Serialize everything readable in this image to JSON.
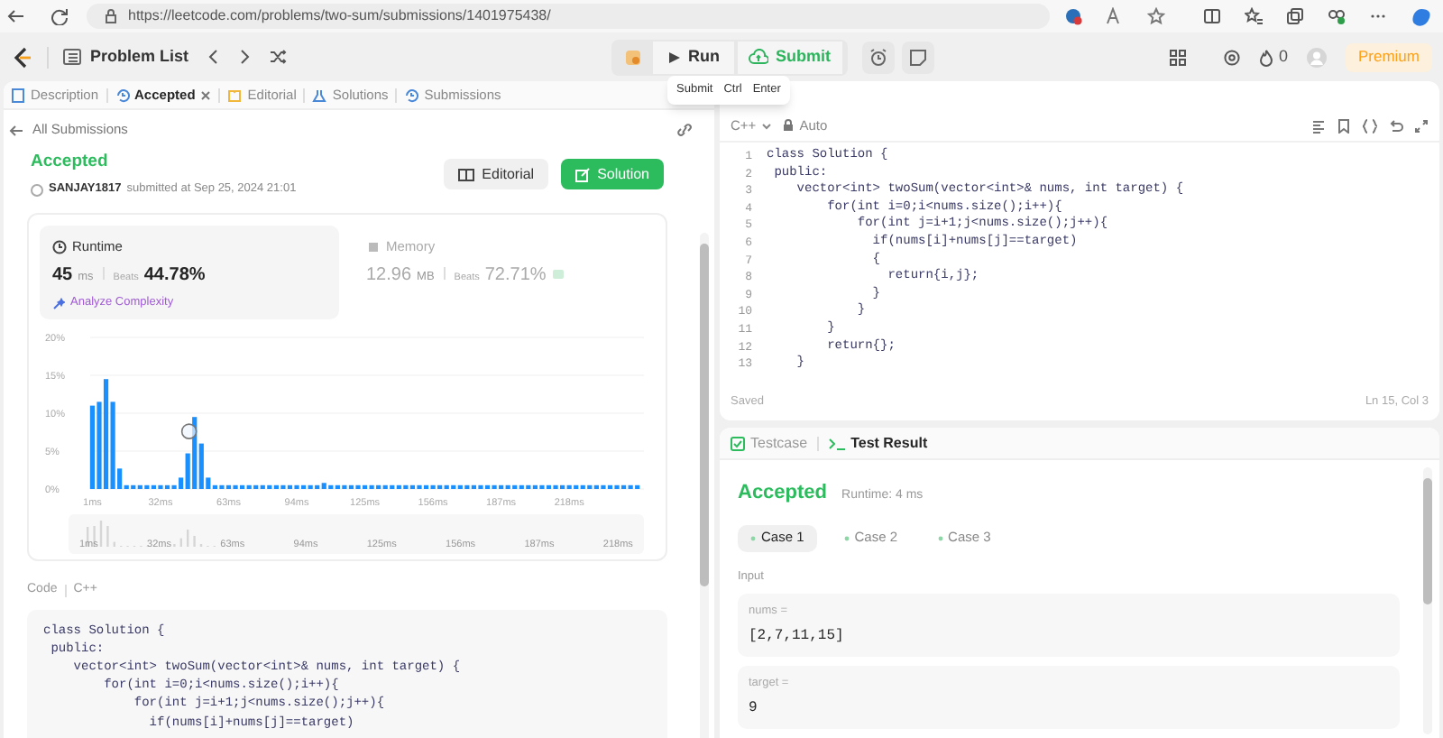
{
  "browser": {
    "url": "https://leetcode.com/problems/two-sum/submissions/1401975438/"
  },
  "nav": {
    "problem_list": "Problem List",
    "run": "Run",
    "submit": "Submit",
    "streak": "0",
    "premium": "Premium"
  },
  "tooltip": {
    "label": "Submit",
    "keys": [
      "Ctrl",
      "Enter"
    ]
  },
  "tabs": [
    {
      "label": "Description",
      "selected": false,
      "closable": false
    },
    {
      "label": "Accepted",
      "selected": true,
      "closable": true
    },
    {
      "label": "Editorial",
      "selected": false,
      "closable": false
    },
    {
      "label": "Solutions",
      "selected": false,
      "closable": false
    },
    {
      "label": "Submissions",
      "selected": false,
      "closable": false
    }
  ],
  "submission": {
    "back": "All Submissions",
    "status": "Accepted",
    "user": "SANJAY1817",
    "submitted": "submitted at Sep 25, 2024 21:01",
    "buttons": [
      {
        "label": "Editorial",
        "kind": "secondary"
      },
      {
        "label": "Solution",
        "kind": "primary"
      }
    ]
  },
  "stats": [
    {
      "title": "Runtime",
      "selected": true,
      "value": "45",
      "unit": "ms",
      "beats_label": "Beats",
      "beats": "44.78%",
      "link": "Analyze Complexity"
    },
    {
      "title": "Memory",
      "selected": false,
      "value": "12.96",
      "unit": "MB",
      "beats_label": "Beats",
      "beats": "72.71%"
    }
  ],
  "runtime_distribution": {
    "chart_data": {
      "type": "bar",
      "xlim": [
        0,
        252
      ],
      "ylim": [
        0,
        20
      ],
      "x": [
        1,
        4.1,
        7.2,
        10.3,
        13.4,
        16.5,
        19.6,
        22.7,
        25.8,
        28.9,
        32,
        35.1,
        38.2,
        41.3,
        44.4,
        47.5,
        50.6,
        53.7,
        56.8,
        59.9,
        63,
        66.1,
        69.2,
        72.3,
        75.4,
        78.5,
        81.6,
        84.7,
        87.8,
        90.9,
        94,
        97.1,
        100.2,
        103.3,
        106.4,
        109.5,
        112.6,
        115.7,
        118.8,
        121.9,
        125,
        128.1,
        131.2,
        134.3,
        137.4,
        140.5,
        143.6,
        146.7,
        149.8,
        152.9,
        156,
        159.1,
        162.2,
        165.3,
        168.4,
        171.5,
        174.6,
        177.7,
        180.8,
        183.9,
        187,
        190.1,
        193.2,
        196.3,
        199.4,
        202.5,
        205.6,
        208.7,
        211.8,
        214.9,
        218,
        221.1,
        224.2,
        227.3,
        230.4,
        233.5,
        236.6,
        239.7,
        242.8,
        245.9,
        249
      ],
      "grid": true,
      "series": [
        {
          "color": "#1a90ff",
          "values": [
            11,
            11.5,
            14.5,
            11.5,
            2.7,
            0.5,
            0.5,
            0.5,
            0.5,
            0.5,
            0.5,
            0.5,
            0.5,
            1.5,
            4.7,
            9.5,
            6,
            1.5,
            0.5,
            0.5,
            0.5,
            0.5,
            0.5,
            0.5,
            0.5,
            0.5,
            0.5,
            0.5,
            0.5,
            0.5,
            0.5,
            0.5,
            0.5,
            0.5,
            0.8,
            0.5,
            0.5,
            0.5,
            0.5,
            0.5,
            0.5,
            0.5,
            0.5,
            0.5,
            0.5,
            0.5,
            0.5,
            0.5,
            0.5,
            0.5,
            0.5,
            0.5,
            0.5,
            0.5,
            0.5,
            0.5,
            0.5,
            0.5,
            0.5,
            0.5,
            0.5,
            0.5,
            0.5,
            0.5,
            0.5,
            0.5,
            0.5,
            0.5,
            0.5,
            0.5,
            0.5,
            0.5,
            0.5,
            0.5,
            0.5,
            0.5,
            0.5,
            0.5,
            0.5,
            0.5,
            0.5
          ]
        }
      ],
      "xticks": [
        {
          "value": 1,
          "label": "1ms"
        },
        {
          "value": 32,
          "label": "32ms"
        },
        {
          "value": 63,
          "label": "63ms"
        },
        {
          "value": 94,
          "label": "94ms"
        },
        {
          "value": 125,
          "label": "125ms"
        },
        {
          "value": 156,
          "label": "156ms"
        },
        {
          "value": 187,
          "label": "187ms"
        },
        {
          "value": 218,
          "label": "218ms"
        }
      ],
      "yticks": [
        {
          "value": 0,
          "label": "0%"
        },
        {
          "value": 5,
          "label": "5%"
        },
        {
          "value": 10,
          "label": "10%"
        },
        {
          "value": 15,
          "label": "15%"
        },
        {
          "value": 20,
          "label": "20%"
        }
      ]
    },
    "overview_labels": [
      "1ms",
      "32ms",
      "63ms",
      "94ms",
      "125ms",
      "156ms",
      "187ms",
      "218ms"
    ]
  },
  "code_section": {
    "label": "Code",
    "language": "C++",
    "lines": [
      "class Solution {",
      " public:",
      "    vector<int> twoSum(vector<int>& nums, int target) {",
      "        for(int i=0;i<nums.size();i++){",
      "            for(int j=i+1;j<nums.size();j++){",
      "              if(nums[i]+nums[j]==target)"
    ]
  },
  "editor": {
    "language": "C++",
    "mode": "Auto",
    "lines": [
      {
        "num": "1",
        "code": "class Solution {"
      },
      {
        "num": "2",
        "code": " public:"
      },
      {
        "num": "3",
        "code": "    vector<int> twoSum(vector<int>& nums, int target) {"
      },
      {
        "num": "4",
        "code": "        for(int i=0;i<nums.size();i++){"
      },
      {
        "num": "5",
        "code": "            for(int j=i+1;j<nums.size();j++){"
      },
      {
        "num": "6",
        "code": "              if(nums[i]+nums[j]==target)"
      },
      {
        "num": "7",
        "code": "              {"
      },
      {
        "num": "8",
        "code": "                return{i,j};"
      },
      {
        "num": "9",
        "code": "              }"
      },
      {
        "num": "10",
        "code": "            }"
      },
      {
        "num": "11",
        "code": "        }"
      },
      {
        "num": "12",
        "code": "        return{};"
      },
      {
        "num": "13",
        "code": "    }"
      }
    ],
    "status": "Saved",
    "cursor": "Ln 15, Col 3"
  },
  "test_panel": {
    "tabs": [
      {
        "label": "Testcase",
        "selected": false
      },
      {
        "label": "Test Result",
        "selected": true
      }
    ],
    "status": "Accepted",
    "runtime": "Runtime: 4 ms",
    "cases": [
      {
        "label": "Case 1",
        "selected": true
      },
      {
        "label": "Case 2",
        "selected": false
      },
      {
        "label": "Case 3",
        "selected": false
      }
    ],
    "input_label": "Input",
    "inputs": [
      {
        "name": "nums =",
        "value": "[2,7,11,15]"
      },
      {
        "name": "target =",
        "value": "9"
      }
    ]
  }
}
